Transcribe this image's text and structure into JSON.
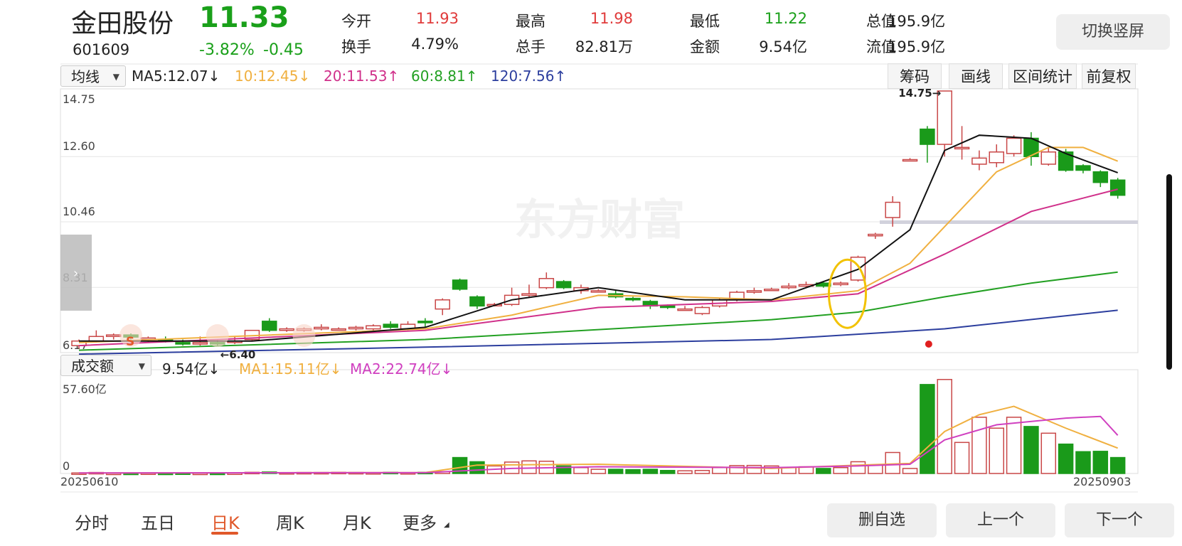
{
  "stock": {
    "name": "金田股份",
    "code": "601609",
    "price": "11.33",
    "change_pct": "-3.82%",
    "change": "-0.45"
  },
  "quote": [
    {
      "label": "今开",
      "value": "11.93",
      "color": "#e03b3b"
    },
    {
      "label": "最高",
      "value": "11.98",
      "color": "#e03b3b"
    },
    {
      "label": "最低",
      "value": "11.22",
      "color": "#1aa01a"
    },
    {
      "label": "总值",
      "value": "195.9亿",
      "color": "#222222"
    },
    {
      "label": "换手",
      "value": "4.79%",
      "color": "#222222"
    },
    {
      "label": "总手",
      "value": "82.81万",
      "color": "#222222"
    },
    {
      "label": "金额",
      "value": "9.54亿",
      "color": "#222222"
    },
    {
      "label": "流值",
      "value": "195.9亿",
      "color": "#222222"
    }
  ],
  "switch_label": "切换竖屏",
  "indicator_select": "均线",
  "ma_legend": [
    {
      "text": "MA5:12.07",
      "arrow": "↓",
      "color": "#222222"
    },
    {
      "text": "10:12.45",
      "arrow": "↓",
      "color": "#f0b040"
    },
    {
      "text": "20:11.53",
      "arrow": "↑",
      "color": "#d0308a"
    },
    {
      "text": "60:8.81",
      "arrow": "↑",
      "color": "#22a022"
    },
    {
      "text": "120:7.56",
      "arrow": "↑",
      "color": "#2c3e9e"
    }
  ],
  "tools": [
    "筹码",
    "画线",
    "区间统计",
    "前复权"
  ],
  "price_axis": [
    "14.75",
    "12.60",
    "10.46",
    "8.31",
    "6.17"
  ],
  "max_marker": "14.75→",
  "min_marker": "←6.40",
  "watermark": "东方财富",
  "volume_select": "成交额",
  "volume_legend": [
    {
      "text": "9.54亿",
      "arrow": "↓",
      "color": "#222222"
    },
    {
      "text": "MA1:15.11亿",
      "arrow": "↓",
      "color": "#f0b040"
    },
    {
      "text": "MA2:22.74亿",
      "arrow": "↓",
      "color": "#d040c0"
    }
  ],
  "volume_axis": [
    "57.60亿",
    "0"
  ],
  "date_start": "20250610",
  "date_end": "20250903",
  "bottom_tabs": [
    "分时",
    "五日",
    "日K",
    "周K",
    "月K",
    "更多"
  ],
  "active_tab": "日K",
  "actions": [
    "删自选",
    "上一个",
    "下一个"
  ],
  "chart_data": {
    "type": "candlestick",
    "price_range": [
      6.17,
      14.75
    ],
    "volume_range": [
      0,
      57.6
    ],
    "candles": [
      [
        6.4,
        6.55,
        6.6,
        6.3
      ],
      [
        6.55,
        6.7,
        6.9,
        6.5
      ],
      [
        6.7,
        6.75,
        6.8,
        6.6
      ],
      [
        6.75,
        6.68,
        6.8,
        6.6
      ],
      [
        6.6,
        6.65,
        6.7,
        6.5
      ],
      [
        6.6,
        6.55,
        6.7,
        6.5
      ],
      [
        6.5,
        6.45,
        6.6,
        6.4
      ],
      [
        6.45,
        6.5,
        6.7,
        6.4
      ],
      [
        6.5,
        6.48,
        6.6,
        6.4
      ],
      [
        6.5,
        6.55,
        6.7,
        6.45
      ],
      [
        6.6,
        6.9,
        6.9,
        6.55
      ],
      [
        7.2,
        6.9,
        7.3,
        6.85
      ],
      [
        6.9,
        6.95,
        7.0,
        6.85
      ],
      [
        6.9,
        6.95,
        7.0,
        6.85
      ],
      [
        6.95,
        7.0,
        7.1,
        6.9
      ],
      [
        6.95,
        6.95,
        7.0,
        6.9
      ],
      [
        6.95,
        7.0,
        7.05,
        6.9
      ],
      [
        6.95,
        7.05,
        7.1,
        6.9
      ],
      [
        7.1,
        7.0,
        7.2,
        6.95
      ],
      [
        6.95,
        7.1,
        7.2,
        6.9
      ],
      [
        7.2,
        7.15,
        7.3,
        7.0
      ],
      [
        7.6,
        7.9,
        7.95,
        7.4
      ],
      [
        8.55,
        8.25,
        8.6,
        8.2
      ],
      [
        8.0,
        7.7,
        8.05,
        7.6
      ],
      [
        7.75,
        7.75,
        7.8,
        7.7
      ],
      [
        7.75,
        8.05,
        8.3,
        7.7
      ],
      [
        8.05,
        8.1,
        8.4,
        8.0
      ],
      [
        8.3,
        8.6,
        8.8,
        8.25
      ],
      [
        8.5,
        8.3,
        8.55,
        8.25
      ],
      [
        8.2,
        8.3,
        8.4,
        8.1
      ],
      [
        8.2,
        8.2,
        8.25,
        8.15
      ],
      [
        8.1,
        8.0,
        8.2,
        7.95
      ],
      [
        7.95,
        7.9,
        8.0,
        7.85
      ],
      [
        7.85,
        7.7,
        7.9,
        7.6
      ],
      [
        7.7,
        7.65,
        7.75,
        7.6
      ],
      [
        7.6,
        7.6,
        7.7,
        7.55
      ],
      [
        7.45,
        7.65,
        7.7,
        7.4
      ],
      [
        7.7,
        7.9,
        7.95,
        7.65
      ],
      [
        7.9,
        8.15,
        8.2,
        7.85
      ],
      [
        8.15,
        8.2,
        8.3,
        8.1
      ],
      [
        8.25,
        8.25,
        8.3,
        8.2
      ],
      [
        8.3,
        8.35,
        8.45,
        8.25
      ],
      [
        8.35,
        8.4,
        8.5,
        8.3
      ],
      [
        8.45,
        8.35,
        8.5,
        8.3
      ],
      [
        8.4,
        8.45,
        8.5,
        8.35
      ],
      [
        8.55,
        9.3,
        9.35,
        8.5
      ],
      [
        10.0,
        10.05,
        10.1,
        9.9
      ],
      [
        10.6,
        11.1,
        11.3,
        10.3
      ],
      [
        12.5,
        12.5,
        12.55,
        12.5
      ],
      [
        13.5,
        13.0,
        13.6,
        12.4
      ],
      [
        13.0,
        14.75,
        14.75,
        12.6
      ],
      [
        12.9,
        12.9,
        13.6,
        12.5
      ],
      [
        12.35,
        12.55,
        12.8,
        12.15
      ],
      [
        12.4,
        12.75,
        13.0,
        12.25
      ],
      [
        12.7,
        13.2,
        13.3,
        12.6
      ],
      [
        13.2,
        12.6,
        13.4,
        12.3
      ],
      [
        12.35,
        12.75,
        12.9,
        12.3
      ],
      [
        12.75,
        12.15,
        12.85,
        12.1
      ],
      [
        12.3,
        12.15,
        12.35,
        12.05
      ],
      [
        12.1,
        11.75,
        12.15,
        11.6
      ],
      [
        11.83,
        11.33,
        11.9,
        11.22
      ]
    ],
    "volumes": [
      0.3,
      0.6,
      0.2,
      0.2,
      0.3,
      0.2,
      0.3,
      0.2,
      0.2,
      0.3,
      0.7,
      0.9,
      0.5,
      0.6,
      0.6,
      0.7,
      0.6,
      0.5,
      0.7,
      0.5,
      0.7,
      1.1,
      9.5,
      7.0,
      4.5,
      6.8,
      7.5,
      7.3,
      4.5,
      3.5,
      2.5,
      2.5,
      2.3,
      2.5,
      1.8,
      1.6,
      1.8,
      3.5,
      4.7,
      4.8,
      4.5,
      3.5,
      4.0,
      3.0,
      3.5,
      7.0,
      5.0,
      12.5,
      3.0,
      53.0,
      56.0,
      18.5,
      33.5,
      27.0,
      33.5,
      28.0,
      24.0,
      17.5,
      13.0,
      13.2,
      9.5
    ],
    "ma_price": {
      "ma5": [
        [
          0,
          6.55
        ],
        [
          10,
          6.55
        ],
        [
          20,
          7.0
        ],
        [
          25,
          7.9
        ],
        [
          30,
          8.3
        ],
        [
          35,
          7.9
        ],
        [
          40,
          7.9
        ],
        [
          45,
          8.9
        ],
        [
          48,
          10.2
        ],
        [
          50,
          12.8
        ],
        [
          52,
          13.3
        ],
        [
          55,
          13.2
        ],
        [
          57,
          12.7
        ],
        [
          60,
          12.07
        ]
      ],
      "ma10": [
        [
          0,
          6.5
        ],
        [
          20,
          6.95
        ],
        [
          25,
          7.4
        ],
        [
          30,
          8.05
        ],
        [
          35,
          8.0
        ],
        [
          40,
          7.9
        ],
        [
          45,
          8.2
        ],
        [
          48,
          9.1
        ],
        [
          50,
          10.3
        ],
        [
          53,
          12.1
        ],
        [
          56,
          12.9
        ],
        [
          58,
          12.9
        ],
        [
          60,
          12.45
        ]
      ],
      "ma20": [
        [
          0,
          6.4
        ],
        [
          20,
          6.9
        ],
        [
          30,
          7.65
        ],
        [
          40,
          7.85
        ],
        [
          45,
          8.1
        ],
        [
          50,
          9.4
        ],
        [
          55,
          10.8
        ],
        [
          60,
          11.53
        ]
      ],
      "ma60": [
        [
          0,
          6.25
        ],
        [
          20,
          6.6
        ],
        [
          40,
          7.25
        ],
        [
          45,
          7.5
        ],
        [
          50,
          8.0
        ],
        [
          55,
          8.45
        ],
        [
          60,
          8.81
        ]
      ],
      "ma120": [
        [
          0,
          6.12
        ],
        [
          20,
          6.35
        ],
        [
          40,
          6.6
        ],
        [
          50,
          6.95
        ],
        [
          60,
          7.56
        ]
      ]
    },
    "ma_volume": {
      "ma1": [
        [
          0,
          0.3
        ],
        [
          20,
          0.6
        ],
        [
          23,
          5.0
        ],
        [
          30,
          5.5
        ],
        [
          40,
          3.0
        ],
        [
          45,
          5.0
        ],
        [
          48,
          6.0
        ],
        [
          50,
          25.0
        ],
        [
          52,
          35.0
        ],
        [
          54,
          40.0
        ],
        [
          57,
          27.0
        ],
        [
          60,
          15.11
        ]
      ],
      "ma2": [
        [
          0,
          0.3
        ],
        [
          20,
          0.5
        ],
        [
          25,
          3.0
        ],
        [
          30,
          4.0
        ],
        [
          40,
          3.5
        ],
        [
          45,
          4.5
        ],
        [
          48,
          5.5
        ],
        [
          50,
          20.0
        ],
        [
          53,
          29.0
        ],
        [
          57,
          33.0
        ],
        [
          59,
          34.0
        ],
        [
          60,
          22.74
        ]
      ]
    }
  }
}
